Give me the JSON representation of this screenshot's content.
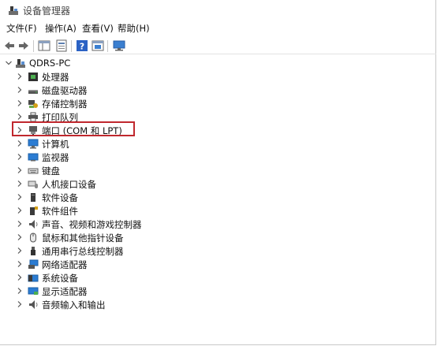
{
  "window": {
    "title": "设备管理器"
  },
  "menu": [
    "文件(F)",
    "操作(A)",
    "查看(V)",
    "帮助(H)"
  ],
  "toolbar": {
    "icons": [
      "back-arrow-icon",
      "forward-arrow-icon",
      "show-hide-tree-icon",
      "properties-icon",
      "help-icon",
      "update-driver-icon",
      "scan-hardware-icon"
    ]
  },
  "tree": {
    "root": {
      "label": "QDRS-PC",
      "expanded": true
    },
    "items": [
      {
        "label": "处理器",
        "icon": "processor-icon"
      },
      {
        "label": "磁盘驱动器",
        "icon": "disk-drive-icon"
      },
      {
        "label": "存储控制器",
        "icon": "storage-controller-icon"
      },
      {
        "label": "打印队列",
        "icon": "printer-icon"
      },
      {
        "label": "端口 (COM 和 LPT)",
        "icon": "port-icon",
        "highlighted": true
      },
      {
        "label": "计算机",
        "icon": "computer-icon"
      },
      {
        "label": "监视器",
        "icon": "monitor-icon"
      },
      {
        "label": "键盘",
        "icon": "keyboard-icon"
      },
      {
        "label": "人机接口设备",
        "icon": "hid-icon"
      },
      {
        "label": "软件设备",
        "icon": "software-device-icon"
      },
      {
        "label": "软件组件",
        "icon": "software-component-icon"
      },
      {
        "label": "声音、视频和游戏控制器",
        "icon": "speaker-icon"
      },
      {
        "label": "鼠标和其他指针设备",
        "icon": "mouse-icon"
      },
      {
        "label": "通用串行总线控制器",
        "icon": "usb-icon"
      },
      {
        "label": "网络适配器",
        "icon": "network-adapter-icon"
      },
      {
        "label": "系统设备",
        "icon": "system-device-icon"
      },
      {
        "label": "显示适配器",
        "icon": "display-adapter-icon"
      },
      {
        "label": "音频输入和输出",
        "icon": "audio-io-icon"
      }
    ]
  },
  "colors": {
    "highlight_border": "#c0282e",
    "icon_blue": "#2b7cd3"
  }
}
